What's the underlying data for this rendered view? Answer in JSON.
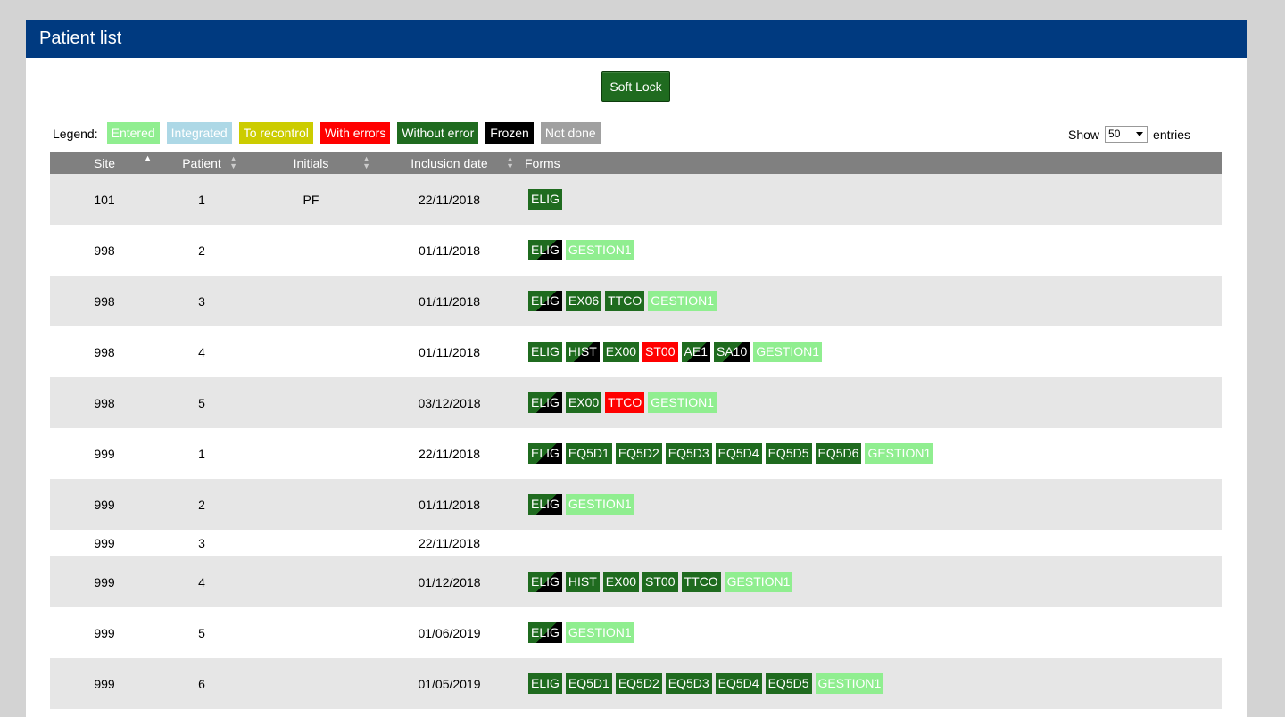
{
  "header": {
    "title": "Patient list"
  },
  "toolbar": {
    "softlock_label": "Soft Lock"
  },
  "legend": {
    "label": "Legend:",
    "items": [
      {
        "label": "Entered",
        "color": "#90ee90"
      },
      {
        "label": "Integrated",
        "color": "#add8e6"
      },
      {
        "label": "To recontrol",
        "color": "#cccc00"
      },
      {
        "label": "With errors",
        "color": "#ff0000"
      },
      {
        "label": "Without error",
        "color": "#1f6b1f"
      },
      {
        "label": "Frozen",
        "color": "#000000"
      },
      {
        "label": "Not done",
        "color": "#a0a0a0"
      }
    ]
  },
  "entries": {
    "show_label": "Show",
    "value": "50",
    "suffix": "entries"
  },
  "table": {
    "columns": [
      "Site",
      "Patient",
      "Initials",
      "Inclusion date",
      "Forms"
    ],
    "rows": [
      {
        "site": "101",
        "patient": "1",
        "initials": "PF",
        "date": "22/11/2018",
        "forms": [
          {
            "name": "ELIG",
            "status": "ok"
          }
        ]
      },
      {
        "site": "998",
        "patient": "2",
        "initials": "",
        "date": "01/11/2018",
        "forms": [
          {
            "name": "ELIG",
            "status": "split"
          },
          {
            "name": "GESTION1",
            "status": "entered"
          }
        ]
      },
      {
        "site": "998",
        "patient": "3",
        "initials": "",
        "date": "01/11/2018",
        "forms": [
          {
            "name": "ELIG",
            "status": "split"
          },
          {
            "name": "EX06",
            "status": "ok"
          },
          {
            "name": "TTCO",
            "status": "ok"
          },
          {
            "name": "GESTION1",
            "status": "entered"
          }
        ]
      },
      {
        "site": "998",
        "patient": "4",
        "initials": "",
        "date": "01/11/2018",
        "forms": [
          {
            "name": "ELIG",
            "status": "ok"
          },
          {
            "name": "HIST",
            "status": "split"
          },
          {
            "name": "EX00",
            "status": "ok"
          },
          {
            "name": "ST00",
            "status": "errors"
          },
          {
            "name": "AE1",
            "status": "split"
          },
          {
            "name": "SA10",
            "status": "split"
          },
          {
            "name": "GESTION1",
            "status": "entered"
          }
        ]
      },
      {
        "site": "998",
        "patient": "5",
        "initials": "",
        "date": "03/12/2018",
        "forms": [
          {
            "name": "ELIG",
            "status": "split"
          },
          {
            "name": "EX00",
            "status": "ok"
          },
          {
            "name": "TTCO",
            "status": "errors"
          },
          {
            "name": "GESTION1",
            "status": "entered"
          }
        ]
      },
      {
        "site": "999",
        "patient": "1",
        "initials": "",
        "date": "22/11/2018",
        "forms": [
          {
            "name": "ELIG",
            "status": "split"
          },
          {
            "name": "EQ5D1",
            "status": "ok"
          },
          {
            "name": "EQ5D2",
            "status": "ok"
          },
          {
            "name": "EQ5D3",
            "status": "ok"
          },
          {
            "name": "EQ5D4",
            "status": "ok"
          },
          {
            "name": "EQ5D5",
            "status": "ok"
          },
          {
            "name": "EQ5D6",
            "status": "ok"
          },
          {
            "name": "GESTION1",
            "status": "entered"
          }
        ]
      },
      {
        "site": "999",
        "patient": "2",
        "initials": "",
        "date": "01/11/2018",
        "forms": [
          {
            "name": "ELIG",
            "status": "split"
          },
          {
            "name": "GESTION1",
            "status": "entered"
          }
        ]
      },
      {
        "site": "999",
        "patient": "3",
        "initials": "",
        "date": "22/11/2018",
        "forms": []
      },
      {
        "site": "999",
        "patient": "4",
        "initials": "",
        "date": "01/12/2018",
        "forms": [
          {
            "name": "ELIG",
            "status": "split"
          },
          {
            "name": "HIST",
            "status": "ok"
          },
          {
            "name": "EX00",
            "status": "ok"
          },
          {
            "name": "ST00",
            "status": "ok"
          },
          {
            "name": "TTCO",
            "status": "ok"
          },
          {
            "name": "GESTION1",
            "status": "entered"
          }
        ]
      },
      {
        "site": "999",
        "patient": "5",
        "initials": "",
        "date": "01/06/2019",
        "forms": [
          {
            "name": "ELIG",
            "status": "split"
          },
          {
            "name": "GESTION1",
            "status": "entered"
          }
        ]
      },
      {
        "site": "999",
        "patient": "6",
        "initials": "",
        "date": "01/05/2019",
        "forms": [
          {
            "name": "ELIG",
            "status": "ok"
          },
          {
            "name": "EQ5D1",
            "status": "ok"
          },
          {
            "name": "EQ5D2",
            "status": "ok"
          },
          {
            "name": "EQ5D3",
            "status": "ok"
          },
          {
            "name": "EQ5D4",
            "status": "ok"
          },
          {
            "name": "EQ5D5",
            "status": "ok"
          },
          {
            "name": "GESTION1",
            "status": "entered"
          }
        ]
      }
    ]
  }
}
